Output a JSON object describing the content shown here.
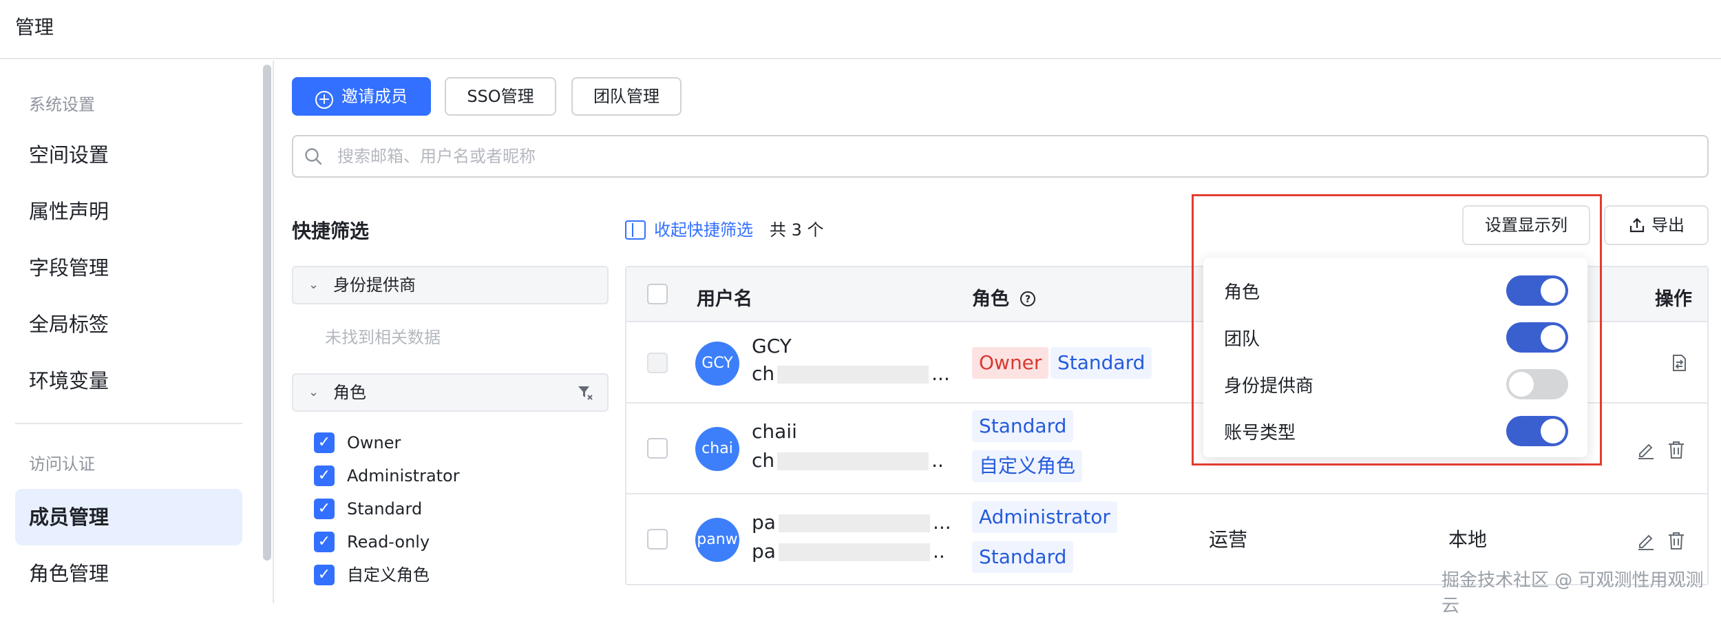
{
  "app": {
    "title": "管理"
  },
  "sidebar": {
    "groups": [
      "系统设置",
      "访问认证"
    ],
    "items": [
      {
        "label": "空间设置",
        "active": false
      },
      {
        "label": "属性声明",
        "active": false
      },
      {
        "label": "字段管理",
        "active": false
      },
      {
        "label": "全局标签",
        "active": false
      },
      {
        "label": "环境变量",
        "active": false
      },
      {
        "label": "成员管理",
        "active": true
      },
      {
        "label": "角色管理",
        "active": false
      }
    ]
  },
  "toolbar": {
    "invite_label": "邀请成员",
    "sso_label": "SSO管理",
    "team_label": "团队管理"
  },
  "search": {
    "placeholder": "搜索邮箱、用户名或者昵称",
    "value": ""
  },
  "quick_filter": {
    "title": "快捷筛选",
    "collapse_label": "收起快捷筛选",
    "total_label": "共 3 个",
    "sections": [
      {
        "label": "身份提供商",
        "empty_text": "未找到相关数据"
      },
      {
        "label": "角色",
        "options": [
          "Owner",
          "Administrator",
          "Standard",
          "Read-only",
          "自定义角色"
        ]
      }
    ]
  },
  "actions": {
    "set_columns_label": "设置显示列",
    "export_label": "导出"
  },
  "columns_menu": {
    "items": [
      {
        "label": "角色",
        "enabled": true
      },
      {
        "label": "团队",
        "enabled": true
      },
      {
        "label": "身份提供商",
        "enabled": false
      },
      {
        "label": "账号类型",
        "enabled": true
      }
    ]
  },
  "table": {
    "headers": {
      "username": "用户名",
      "role": "角色",
      "actions": "操作"
    },
    "rows": [
      {
        "avatar": "GCY",
        "name": "GCY",
        "email_prefix": "ch",
        "email_suffix": "...",
        "roles": [
          "Owner",
          "Standard"
        ],
        "team": "",
        "account_type": ""
      },
      {
        "avatar": "chai",
        "name": "chaii",
        "email_prefix": "ch",
        "email_suffix": "..",
        "roles": [
          "Standard",
          "自定义角色"
        ],
        "team": "",
        "account_type": ""
      },
      {
        "avatar": "panw",
        "name_prefix": "pa",
        "name_suffix": "...",
        "email_prefix": "pa",
        "email_suffix": "..",
        "roles": [
          "Administrator",
          "Standard"
        ],
        "team": "运营",
        "account_type": "本地"
      }
    ]
  },
  "watermark": "掘金技术社区 @ 可观测性用观测云",
  "colors": {
    "primary": "#3370ff",
    "highlight_border": "#e23c2e",
    "toggle_on": "#3a5fcf",
    "owner_tag": "#d83931"
  }
}
